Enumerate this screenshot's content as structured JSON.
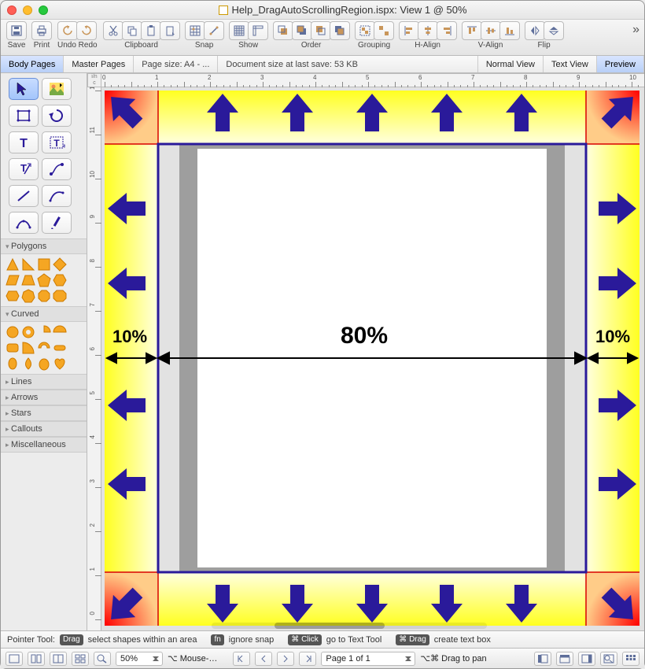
{
  "window": {
    "title": "Help_DragAutoScrollingRegion.ispx: View 1 @ 50%"
  },
  "toolbar": {
    "save": "Save",
    "print": "Print",
    "undoredo": "Undo Redo",
    "clipboard": "Clipboard",
    "snap": "Snap",
    "show": "Show",
    "order": "Order",
    "grouping": "Grouping",
    "halign": "H-Align",
    "valign": "V-Align",
    "flip": "Flip"
  },
  "tabs": {
    "body": "Body Pages",
    "master": "Master Pages",
    "pagesize": "Page size:  A4 - ...",
    "docsize": "Document size at last save:  53 KB",
    "normal": "Normal View",
    "text": "Text View",
    "preview": "Preview"
  },
  "sidepanels": {
    "polygons": "Polygons",
    "curved": "Curved",
    "lines": "Lines",
    "arrows": "Arrows",
    "stars": "Stars",
    "callouts": "Callouts",
    "misc": "Miscellaneous"
  },
  "canvas": {
    "left_pct": "10%",
    "center_pct": "80%",
    "right_pct": "10%"
  },
  "hints": {
    "toolname": "Pointer Tool:",
    "drag_label": "Drag",
    "drag_text": "select shapes within an area",
    "fn_label": "fn",
    "fn_text": "ignore snap",
    "click_label": "⌘ Click",
    "click_text": "go to Text Tool",
    "cdrag_label": "⌘ Drag",
    "cdrag_text": "create text box"
  },
  "footer": {
    "zoom": "50%",
    "mouse": "⌥ Mouse-…",
    "page": "Page 1 of 1",
    "pan": "⌥⌘ Drag to pan"
  }
}
